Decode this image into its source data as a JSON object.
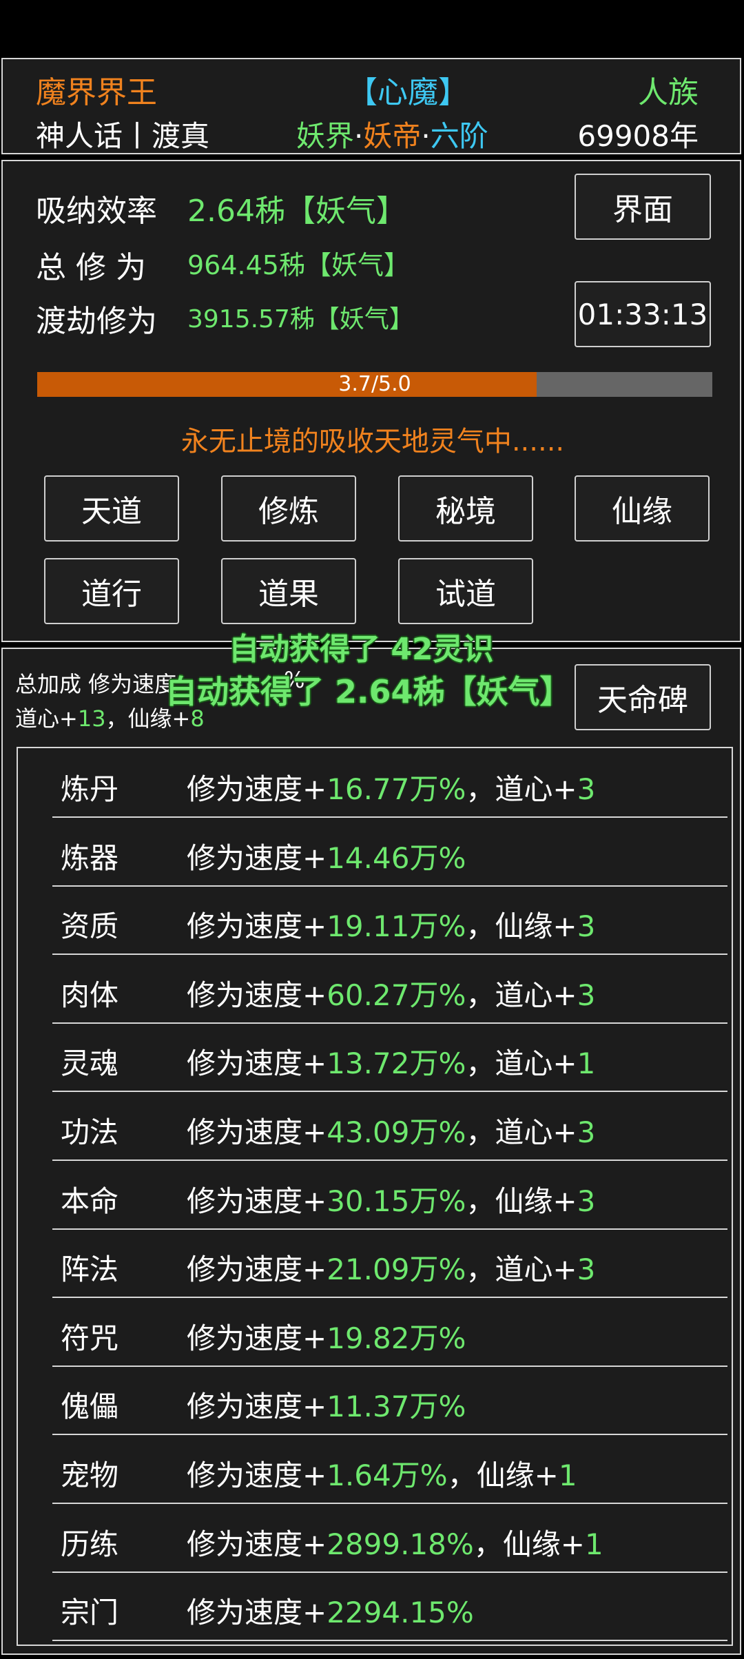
{
  "header": {
    "realm_title": "魔界界王",
    "demon_tag": "【心魔】",
    "race": "人族",
    "world_name": "神人话丨渡真",
    "realm_world": "妖界",
    "realm_dot1": "·",
    "realm_rank": "妖帝",
    "realm_dot2": "·",
    "realm_stage": "六阶",
    "years": "69908年"
  },
  "stats": {
    "absorb_label": "吸纳效率",
    "absorb_value": "2.64秭【妖气】",
    "total_label": "总 修 为",
    "total_value": "964.45秭【妖气】",
    "tribulation_label": "渡劫修为",
    "tribulation_value": "3915.57秭【妖气】",
    "interface_button": "界面",
    "timer": "01:33:13"
  },
  "progress": {
    "text": "3.7/5.0",
    "fraction": 0.74
  },
  "status_message": "永无止境的吸收天地灵气中......",
  "actions": [
    "天道",
    "修炼",
    "秘境",
    "仙缘",
    "道行",
    "道果",
    "试道"
  ],
  "bonus": {
    "line1": "总加成 修为速度",
    "line1_tail": "%",
    "line2_a": "道心+",
    "line2_b": "13",
    "line2_c": "，仙缘+",
    "line2_d": "8",
    "heaven_button": "天命碑"
  },
  "toasts": {
    "first": "自动获得了 42灵识",
    "second": "自动获得了 2.64秭【妖气】"
  },
  "list": [
    {
      "name": "炼丹",
      "prefix": "修为速度+",
      "value": "16.77万%",
      "extra_label": "，道心+",
      "extra_value": "3"
    },
    {
      "name": "炼器",
      "prefix": "修为速度+",
      "value": "14.46万%",
      "extra_label": "",
      "extra_value": ""
    },
    {
      "name": "资质",
      "prefix": "修为速度+",
      "value": "19.11万%",
      "extra_label": "，仙缘+",
      "extra_value": "3"
    },
    {
      "name": "肉体",
      "prefix": "修为速度+",
      "value": "60.27万%",
      "extra_label": "，道心+",
      "extra_value": "3"
    },
    {
      "name": "灵魂",
      "prefix": "修为速度+",
      "value": "13.72万%",
      "extra_label": "，道心+",
      "extra_value": "1"
    },
    {
      "name": "功法",
      "prefix": "修为速度+",
      "value": "43.09万%",
      "extra_label": "，道心+",
      "extra_value": "3"
    },
    {
      "name": "本命",
      "prefix": "修为速度+",
      "value": "30.15万%",
      "extra_label": "，仙缘+",
      "extra_value": "3"
    },
    {
      "name": "阵法",
      "prefix": "修为速度+",
      "value": "21.09万%",
      "extra_label": "，道心+",
      "extra_value": "3"
    },
    {
      "name": "符咒",
      "prefix": "修为速度+",
      "value": "19.82万%",
      "extra_label": "",
      "extra_value": ""
    },
    {
      "name": "傀儡",
      "prefix": "修为速度+",
      "value": "11.37万%",
      "extra_label": "",
      "extra_value": ""
    },
    {
      "name": "宠物",
      "prefix": "修为速度+",
      "value": "1.64万%",
      "extra_label": "，仙缘+",
      "extra_value": "1"
    },
    {
      "name": "历练",
      "prefix": "修为速度+",
      "value": "2899.18%",
      "extra_label": "，仙缘+",
      "extra_value": "1"
    },
    {
      "name": "宗门",
      "prefix": "修为速度+",
      "value": "2294.15%",
      "extra_label": "",
      "extra_value": ""
    }
  ]
}
